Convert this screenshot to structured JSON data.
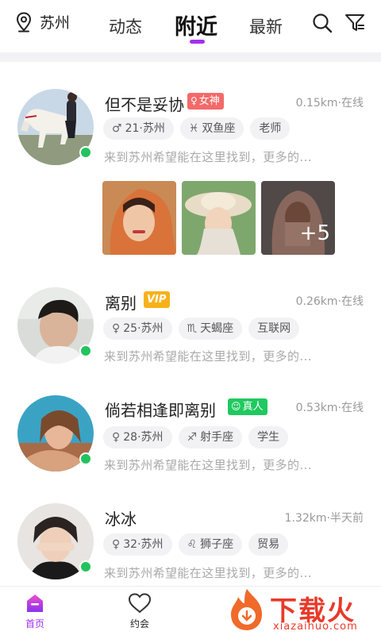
{
  "header": {
    "location": "苏州",
    "tabs": [
      {
        "label": "动态"
      },
      {
        "label": "附近"
      },
      {
        "label": "最新"
      }
    ],
    "active_tab": "附近",
    "icons": [
      "location-pin-icon",
      "search-icon",
      "filter-icon"
    ],
    "accent_color": "#a32ff0"
  },
  "users": [
    {
      "name": "但不是妥协",
      "badge": {
        "label": "女神",
        "icon": "venus-icon",
        "color": "#f46a6a"
      },
      "distance": "0.15km",
      "status": "在线",
      "tags": [
        {
          "icon": "male-icon",
          "text": "21·苏州"
        },
        {
          "icon": "pisces-icon",
          "text": "双鱼座"
        },
        {
          "text": "老师"
        }
      ],
      "bio": "来到苏州希望能在这里找到，更多的...",
      "photos_more": "+5",
      "online": true
    },
    {
      "name": "离别",
      "badge": {
        "label": "VIP",
        "color": "#f7b21a"
      },
      "distance": "0.26km",
      "status": "在线",
      "tags": [
        {
          "icon": "female-icon",
          "text": "25·苏州"
        },
        {
          "icon": "scorpio-icon",
          "text": "天蝎座"
        },
        {
          "text": "互联网"
        }
      ],
      "bio": "来到苏州希望能在这里找到，更多的...",
      "online": true
    },
    {
      "name": "倘若相逢即离别",
      "badge": {
        "label": "真人",
        "icon": "verified-face-icon",
        "color": "#1fc95f"
      },
      "distance": "0.53km",
      "status": "在线",
      "tags": [
        {
          "icon": "female-icon",
          "text": "28·苏州"
        },
        {
          "icon": "sagittarius-icon",
          "text": "射手座"
        },
        {
          "text": "学生"
        }
      ],
      "bio": "来到苏州希望能在这里找到，更多的...",
      "online": true
    },
    {
      "name": "冰冰",
      "distance": "1.32km",
      "status": "半天前",
      "tags": [
        {
          "icon": "female-icon",
          "text": "32·苏州"
        },
        {
          "icon": "leo-icon",
          "text": "狮子座"
        },
        {
          "text": "贸易"
        }
      ],
      "bio": "来到苏州希望能在这里找到，更多的...",
      "online": true
    }
  ],
  "bottom_nav": [
    {
      "label": "首页",
      "icon": "home-icon",
      "active": true
    },
    {
      "label": "约会",
      "icon": "heart-icon",
      "active": false
    }
  ],
  "watermark": {
    "title": "下载火",
    "subtitle": "xiazaihuo.com"
  }
}
